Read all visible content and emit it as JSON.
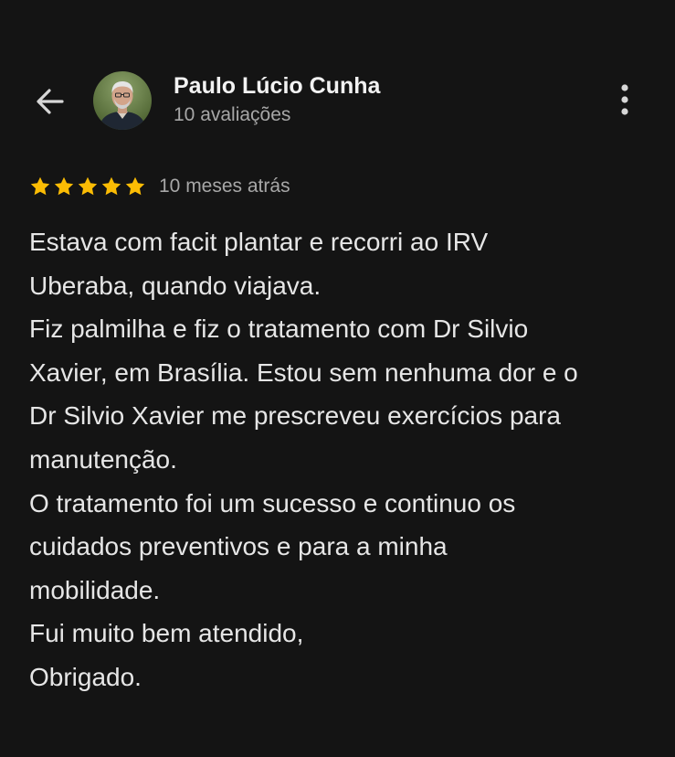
{
  "header": {
    "back_icon": "arrow-left-icon",
    "reviewer_name": "Paulo Lúcio Cunha",
    "reviews_count": "10 avaliações",
    "menu_icon": "more-vert-icon"
  },
  "review": {
    "rating": 5,
    "rating_max": 5,
    "star_color": "#fbbc04",
    "time": "10 meses atrás",
    "lines": [
      "Estava com facit plantar e recorri ao IRV",
      "Uberaba, quando viajava.",
      "Fiz palmilha e fiz o tratamento com Dr Silvio",
      "Xavier, em Brasília. Estou sem nenhuma dor e o",
      "Dr Silvio Xavier me prescreveu exercícios para",
      "manutenção.",
      "O tratamento foi um sucesso e continuo os",
      "cuidados preventivos e para a minha",
      "mobilidade.",
      "Fui muito bem atendido,",
      "Obrigado."
    ]
  },
  "colors": {
    "background": "#141414",
    "text_primary": "#e6e6e6",
    "text_secondary": "#a7a7a7"
  }
}
